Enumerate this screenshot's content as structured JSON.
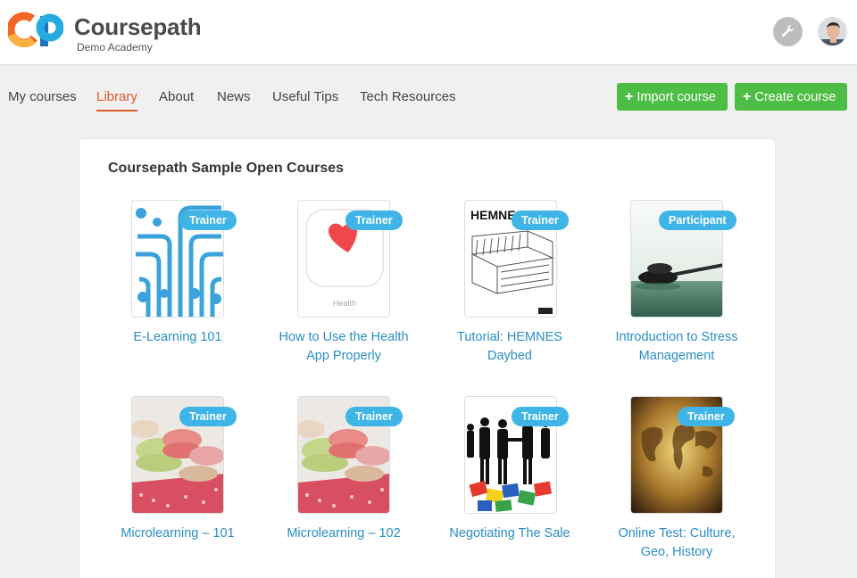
{
  "app": {
    "brand_name": "Coursepath",
    "brand_sub": "Demo Academy"
  },
  "nav": {
    "items": [
      {
        "label": "My courses"
      },
      {
        "label": "Library"
      },
      {
        "label": "About"
      },
      {
        "label": "News"
      },
      {
        "label": "Useful Tips"
      },
      {
        "label": "Tech Resources"
      }
    ],
    "active": "Library"
  },
  "actions": {
    "import_label": "Import course",
    "create_label": "Create course",
    "plus_glyph": "+"
  },
  "section": {
    "title": "Coursepath Sample Open Courses"
  },
  "courses": [
    {
      "badge": "Trainer",
      "title_line1": "E-Learning 101",
      "title_line2": "",
      "thumb": "elearning-art"
    },
    {
      "badge": "Trainer",
      "title_line1": "How to Use the Health",
      "title_line2": "App Properly",
      "thumb": "health-app-icon",
      "thumb_text": "Health"
    },
    {
      "badge": "Trainer",
      "title_line1": "Tutorial: HEMNES",
      "title_line2": "Daybed",
      "thumb": "hemnes-daybed-sketch",
      "thumb_text": "HEMNES"
    },
    {
      "badge": "Participant",
      "title_line1": "Introduction to Stress",
      "title_line2": "Management",
      "thumb": "zen-stones-photo"
    },
    {
      "badge": "Trainer",
      "title_line1": "Microlearning – 101",
      "title_line2": "",
      "thumb": "macarons-photo"
    },
    {
      "badge": "Trainer",
      "title_line1": "Microlearning – 102",
      "title_line2": "",
      "thumb": "macarons-photo"
    },
    {
      "badge": "Trainer",
      "title_line1": "Negotiating The Sale",
      "title_line2": "",
      "thumb": "handshake-puzzle"
    },
    {
      "badge": "Trainer",
      "title_line1": "Online Test: Culture,",
      "title_line2": "Geo, History",
      "thumb": "world-map-parchment"
    }
  ],
  "colors": {
    "accent": "#e25b2c",
    "primary_button": "#4dbd45",
    "badge": "#3fb4e6",
    "link": "#2a8ec4"
  },
  "icons": {
    "tools": "wrench-icon",
    "avatar": "user-avatar"
  }
}
